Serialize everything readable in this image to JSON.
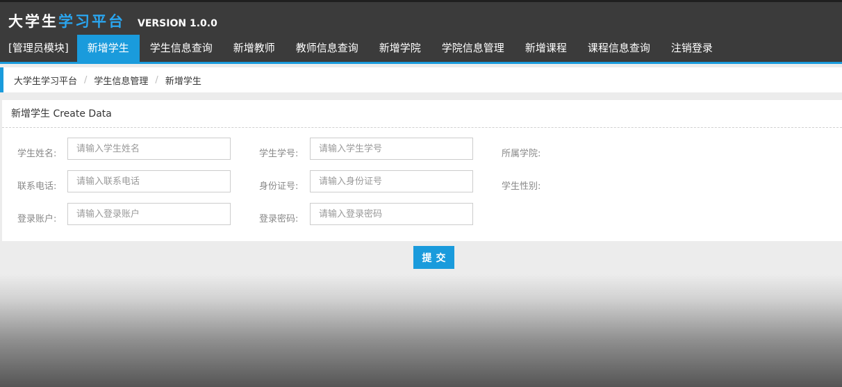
{
  "header": {
    "brand_part1": "大学生",
    "brand_part2": "学习平台",
    "version": "VERSION 1.0.0"
  },
  "nav": {
    "module_label": "[管理员模块]",
    "items": [
      {
        "label": "新增学生",
        "active": true
      },
      {
        "label": "学生信息查询",
        "active": false
      },
      {
        "label": "新增教师",
        "active": false
      },
      {
        "label": "教师信息查询",
        "active": false
      },
      {
        "label": "新增学院",
        "active": false
      },
      {
        "label": "学院信息管理",
        "active": false
      },
      {
        "label": "新增课程",
        "active": false
      },
      {
        "label": "课程信息查询",
        "active": false
      },
      {
        "label": "注销登录",
        "active": false
      }
    ]
  },
  "breadcrumb": [
    "大学生学习平台",
    "学生信息管理",
    "新增学生"
  ],
  "breadcrumb_separator": "/",
  "form": {
    "title": "新增学生 Create Data",
    "fields": {
      "name": {
        "label": "学生姓名:",
        "placeholder": "请输入学生姓名",
        "value": ""
      },
      "student_no": {
        "label": "学生学号:",
        "placeholder": "请输入学生学号",
        "value": ""
      },
      "college": {
        "label": "所属学院:"
      },
      "phone": {
        "label": "联系电话:",
        "placeholder": "请输入联系电话",
        "value": ""
      },
      "id_card": {
        "label": "身份证号:",
        "placeholder": "请输入身份证号",
        "value": ""
      },
      "gender": {
        "label": "学生性别:"
      },
      "account": {
        "label": "登录账户:",
        "placeholder": "请输入登录账户",
        "value": ""
      },
      "password": {
        "label": "登录密码:",
        "placeholder": "请输入登录密码",
        "value": ""
      }
    },
    "submit_label": "提交"
  },
  "colors": {
    "accent": "#1a9bdc",
    "header_bg": "#3b3b3b",
    "brand_highlight": "#2aa6f0"
  }
}
